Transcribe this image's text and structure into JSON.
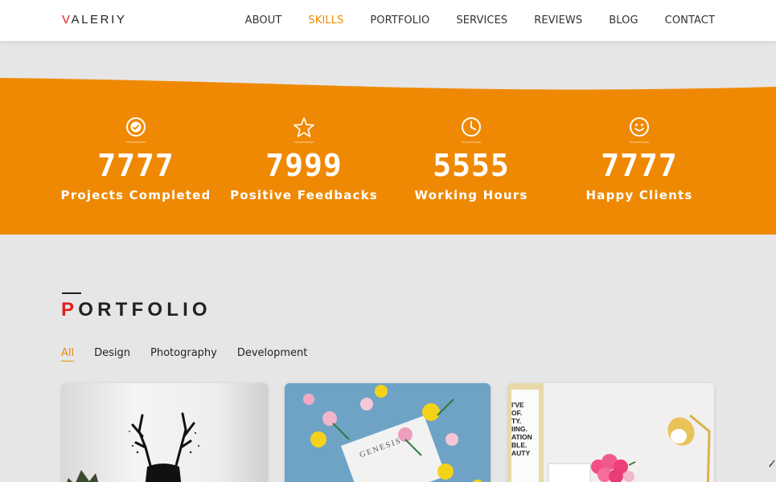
{
  "header": {
    "logo_first": "V",
    "logo_rest": "ALERIY",
    "nav": [
      {
        "label": "ABOUT",
        "active": false
      },
      {
        "label": "SKILLS",
        "active": true
      },
      {
        "label": "PORTFOLIO",
        "active": false
      },
      {
        "label": "SERVICES",
        "active": false
      },
      {
        "label": "REVIEWS",
        "active": false
      },
      {
        "label": "BLOG",
        "active": false
      },
      {
        "label": "CONTACT",
        "active": false
      }
    ]
  },
  "stats": [
    {
      "icon": "checkmark-circle-icon",
      "value": "7777",
      "label": "Projects Completed"
    },
    {
      "icon": "star-icon",
      "value": "7999",
      "label": "Positive Feedbacks"
    },
    {
      "icon": "clock-icon",
      "value": "5555",
      "label": "Working Hours"
    },
    {
      "icon": "smiley-icon",
      "value": "7777",
      "label": "Happy Clients"
    }
  ],
  "portfolio": {
    "title_first": "P",
    "title_rest": "ORTFOLIO",
    "filters": [
      "All",
      "Design",
      "Photography",
      "Development"
    ],
    "active_filter": "All",
    "cards": [
      {
        "image": "deer-silhouette-art"
      },
      {
        "image": "genesis-magazine-flowers",
        "text": "GENESIS"
      },
      {
        "image": "desk-lamp-roses-poster",
        "text": [
          "I'VE",
          "OF.",
          "TY.",
          "IING.",
          "ATION",
          "BLE.",
          "AUTY"
        ]
      }
    ]
  },
  "colors": {
    "accent": "#f08a00",
    "band": "#ef8903",
    "brand_red": "#e01f1f"
  }
}
